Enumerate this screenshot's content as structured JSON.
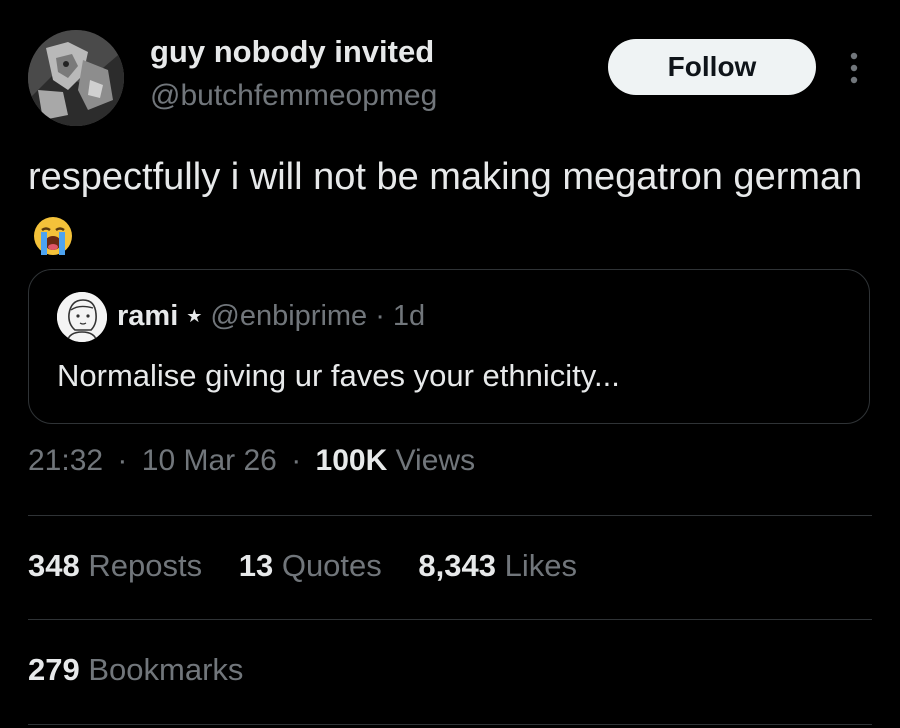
{
  "author": {
    "name": "guy nobody invited",
    "handle": "@butchfemmeopmeg",
    "avatar": "avatar-dark-robot-icon"
  },
  "follow_label": "Follow",
  "more_icon": "more-vertical-icon",
  "tweet": {
    "text": "respectfully i will not be making megatron german",
    "emoji": "loudly-crying-face-icon"
  },
  "quote": {
    "name": "rami",
    "star": "★",
    "handle": "@enbiprime",
    "separator": "·",
    "age": "1d",
    "text": "Normalise giving ur faves your ethnicity..."
  },
  "meta": {
    "time": "21:32",
    "dot1": "·",
    "date": "10 Mar 26",
    "dot2": "·",
    "views_count": "100K",
    "views_label": "Views"
  },
  "stats": {
    "reposts_count": "348",
    "reposts_label": "Reposts",
    "quotes_count": "13",
    "quotes_label": "Quotes",
    "likes_count": "8,343",
    "likes_label": "Likes",
    "bookmarks_count": "279",
    "bookmarks_label": "Bookmarks"
  },
  "colors": {
    "background": "#000000",
    "primary_text": "#e7e9ea",
    "secondary_text": "#71767b",
    "divider": "#2f3336",
    "follow_bg": "#eff3f4"
  }
}
